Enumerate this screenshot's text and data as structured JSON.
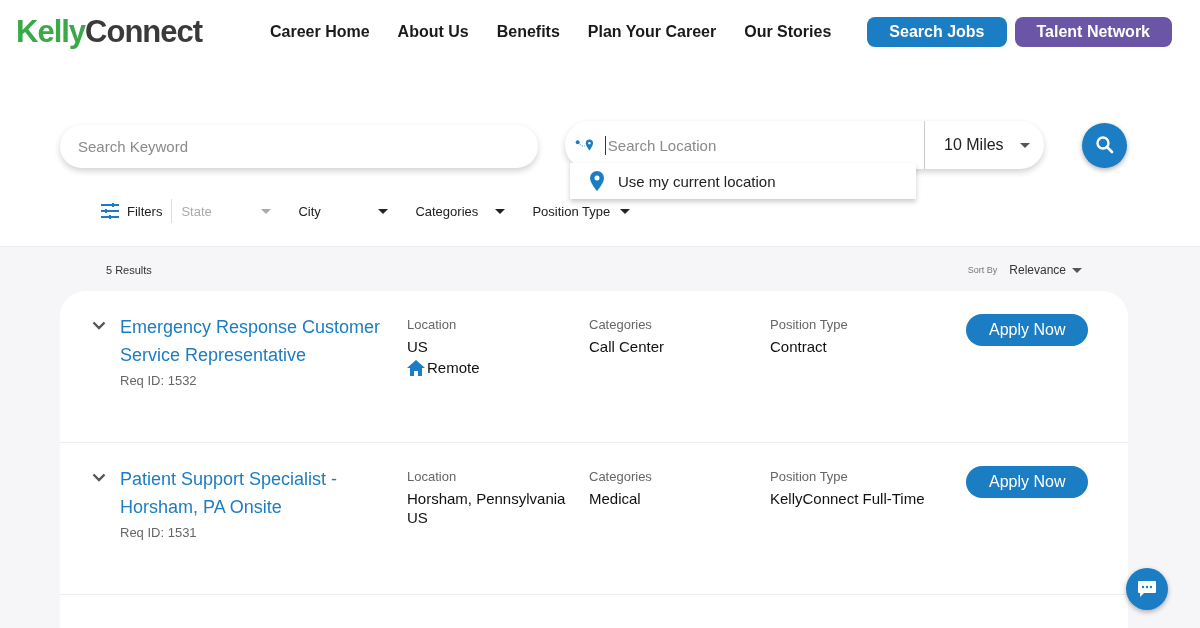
{
  "logo": {
    "first": "Kelly",
    "second": "Connect"
  },
  "nav": [
    {
      "label": "Career Home",
      "kind": "link"
    },
    {
      "label": "About Us",
      "kind": "link"
    },
    {
      "label": "Benefits",
      "kind": "link"
    },
    {
      "label": "Plan Your Career",
      "kind": "link"
    },
    {
      "label": "Our Stories",
      "kind": "link"
    },
    {
      "label": "Search Jobs",
      "kind": "primary"
    },
    {
      "label": "Talent Network",
      "kind": "secondary"
    }
  ],
  "search": {
    "keyword_placeholder": "Search Keyword",
    "location_placeholder": "Search Location",
    "radius": "10 Miles",
    "suggestion": "Use my current location"
  },
  "filters": {
    "label": "Filters",
    "dropdowns": [
      {
        "label": "State",
        "disabled": true
      },
      {
        "label": "City",
        "disabled": false
      },
      {
        "label": "Categories",
        "disabled": false
      },
      {
        "label": "Position Type",
        "disabled": false
      }
    ]
  },
  "results": {
    "count": "5 Results",
    "sort_label": "Sort By",
    "sort_value": "Relevance"
  },
  "jobs": [
    {
      "title": "Emergency Response Customer Service Representative",
      "req": "Req ID: 1532",
      "location_label": "Location",
      "location": [
        "US"
      ],
      "remote": "Remote",
      "categories_label": "Categories",
      "category": "Call Center",
      "type_label": "Position Type",
      "type": "Contract",
      "apply": "Apply Now"
    },
    {
      "title": "Patient Support Specialist - Horsham, PA Onsite",
      "req": "Req ID: 1531",
      "location_label": "Location",
      "location": [
        "Horsham, Pennsylvania",
        "US"
      ],
      "categories_label": "Categories",
      "category": "Medical",
      "type_label": "Position Type",
      "type": "KellyConnect Full-Time",
      "apply": "Apply Now"
    }
  ]
}
